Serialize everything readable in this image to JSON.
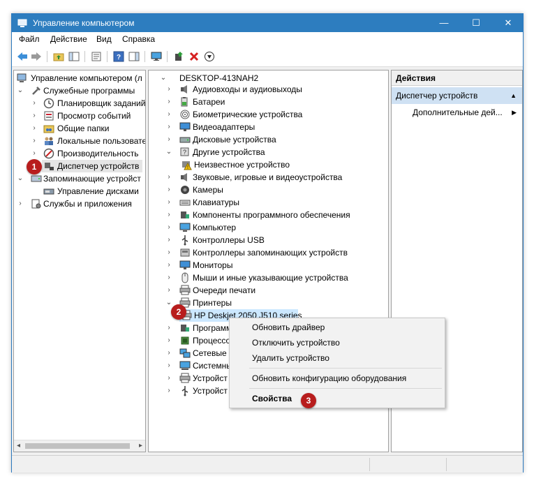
{
  "window": {
    "title": "Управление компьютером",
    "minimize": "—",
    "maximize": "☐",
    "close": "✕"
  },
  "menu": [
    "Файл",
    "Действие",
    "Вид",
    "Справка"
  ],
  "toolbar": {
    "icons": [
      "back-icon",
      "forward-icon",
      "up-folder-icon",
      "show-tree-icon",
      "properties-icon",
      "help-icon",
      "show-action-pane-icon",
      "monitor-icon",
      "update-driver-icon",
      "uninstall-icon",
      "download-icon"
    ]
  },
  "left_tree": {
    "root": "Управление компьютером (л",
    "items": [
      {
        "label": "Служебные программы"
      },
      {
        "label": "Планировщик заданий"
      },
      {
        "label": "Просмотр событий"
      },
      {
        "label": "Общие папки"
      },
      {
        "label": "Локальные пользовате"
      },
      {
        "label": "Производительность"
      },
      {
        "label": "Диспетчер устройств"
      },
      {
        "label": "Запоминающие устройст"
      },
      {
        "label": "Управление дисками"
      },
      {
        "label": "Службы и приложения"
      }
    ]
  },
  "device_tree": {
    "root": "DESKTOP-413NAH2",
    "categories": [
      "Аудиовходы и аудиовыходы",
      "Батареи",
      "Биометрические устройства",
      "Видеоадаптеры",
      "Дисковые устройства",
      "Другие устройства",
      "Неизвестное устройство",
      "Звуковые, игровые и видеоустройства",
      "Камеры",
      "Клавиатуры",
      "Компоненты программного обеспечения",
      "Компьютер",
      "Контроллеры USB",
      "Контроллеры запоминающих устройств",
      "Мониторы",
      "Мыши и иные указывающие устройства",
      "Очереди печати",
      "Принтеры",
      "HP Deskjet 2050 J510 series",
      "Программ",
      "Процессо",
      "Сетевые а",
      "Системны",
      "Устройст",
      "Устройст"
    ]
  },
  "context_menu": {
    "items": [
      "Обновить драйвер",
      "Отключить устройство",
      "Удалить устройство",
      "Обновить конфигурацию оборудования",
      "Свойства"
    ]
  },
  "actions_pane": {
    "header": "Действия",
    "section": "Диспетчер устройств",
    "more": "Дополнительные дей..."
  },
  "badges": [
    "1",
    "2",
    "3"
  ],
  "colors": {
    "titlebar": "#2d7dbf",
    "badge": "#b81d1d",
    "selected_section": "#cfe1f3"
  }
}
